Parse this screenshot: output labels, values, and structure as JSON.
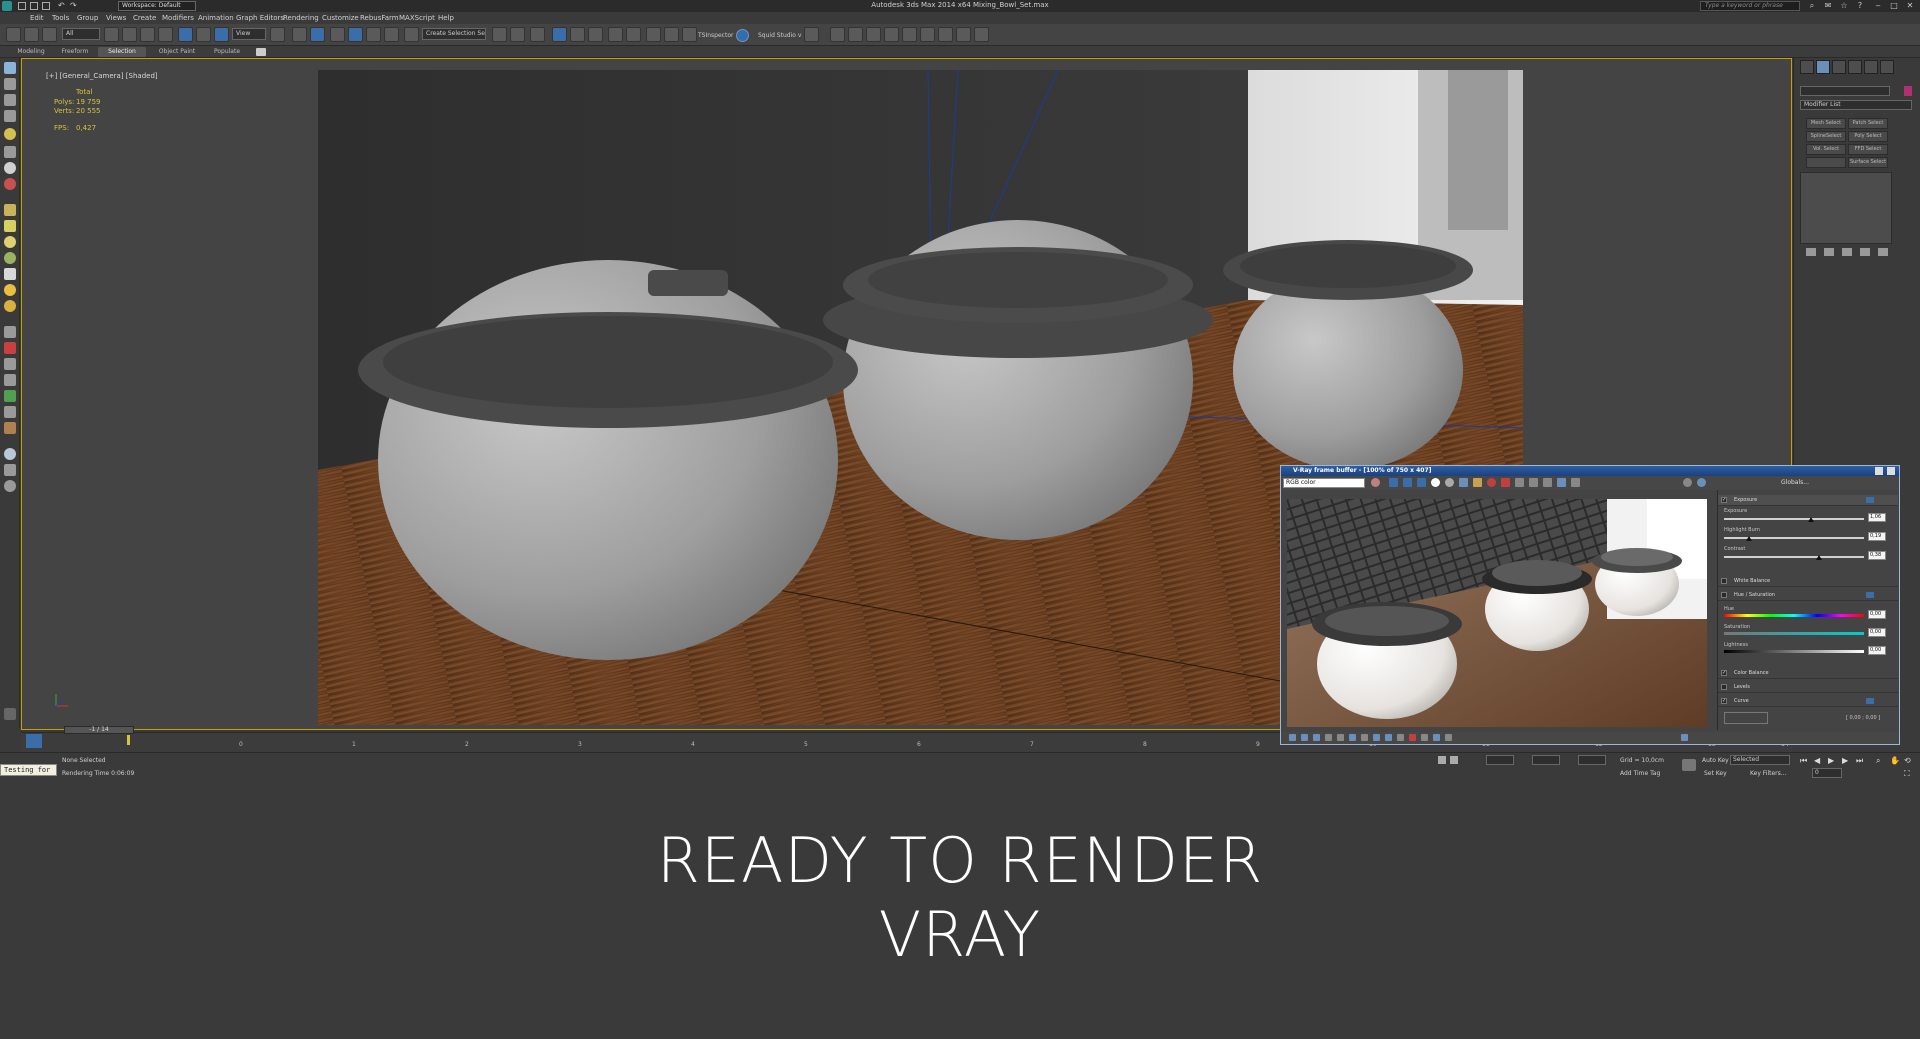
{
  "titlebar": {
    "workspace": "Workspace: Default",
    "app_title": "Autodesk 3ds Max  2014 x64    Mixing_Bowl_Set.max",
    "search_placeholder": "Type a keyword or phrase"
  },
  "menu": [
    "Edit",
    "Tools",
    "Group",
    "Views",
    "Create",
    "Modifiers",
    "Animation",
    "Graph Editors",
    "Rendering",
    "Customize",
    "RebusFarm",
    "MAXScript",
    "Help"
  ],
  "toolbar": {
    "selection_filter": "All",
    "coord_system": "View",
    "named_selection": "Create Selection Se",
    "tsinspector": "TSInspector",
    "squid_studio": "Squid Studio v"
  },
  "ribbon_tabs": [
    "Modeling",
    "Freeform",
    "Selection",
    "Object Paint",
    "Populate"
  ],
  "ribbon_active": "Selection",
  "viewport": {
    "label": "[+] [General_Camera] [Shaded]",
    "stats_total": "Total",
    "stats_polys_label": "Polys:",
    "stats_polys": "19 759",
    "stats_verts_label": "Verts:",
    "stats_verts": "20 555",
    "fps_label": "FPS:",
    "fps": "0,427"
  },
  "command_panel": {
    "modifier_list": "Modifier List",
    "buttons": [
      "Mesh Select",
      "Patch Select",
      "SplineSelect",
      "Poly Select",
      "Vol. Select",
      "FFD Select",
      "",
      "Surface Select"
    ]
  },
  "timeline": {
    "slider": "-1 / 14",
    "ticks": [
      "0",
      "1",
      "2",
      "3",
      "4",
      "5",
      "6",
      "7",
      "8",
      "9",
      "10",
      "11",
      "12",
      "13",
      "14"
    ]
  },
  "status": {
    "maxscript": "Testing for",
    "selection": "None Selected",
    "rendering_time": "Rendering Time  0:06:09",
    "grid": "Grid = 10,0cm",
    "add_time_tag": "Add Time Tag",
    "auto_key": "Auto Key",
    "selected": "Selected",
    "set_key": "Set Key",
    "key_filters": "Key Filters...",
    "frame": "0"
  },
  "vfb": {
    "title": "V-Ray frame buffer - [100% of 750 x 407]",
    "channel": "RGB color",
    "globals": "Globals...",
    "exposure_section": "Exposure",
    "exposure_label": "Exposure",
    "exposure_value": "1,06",
    "exposure_pos": 0.62,
    "highlight_label": "Highlight Burn",
    "highlight_value": "0,19",
    "highlight_pos": 0.18,
    "contrast_label": "Contrast",
    "contrast_value": "0,38",
    "contrast_pos": 0.68,
    "white_balance": "White Balance",
    "hue_saturation": "Hue / Saturation",
    "hue_label": "Hue",
    "hue_value": "0,00",
    "saturation_label": "Saturation",
    "saturation_value": "0,00",
    "lightness_label": "Lightness",
    "lightness_value": "0,00",
    "color_balance": "Color Balance",
    "levels": "Levels",
    "curve": "Curve",
    "curve_readout": "[ 0,00 ; 0,00 ]"
  },
  "caption": {
    "line1": "READY TO RENDER",
    "line2": "VRAY"
  },
  "colors": {
    "viewport_border": "#c6a000",
    "stats": "#d6c33a",
    "vfb_title": "#2d5fa3",
    "wood": "#6b3f22"
  }
}
